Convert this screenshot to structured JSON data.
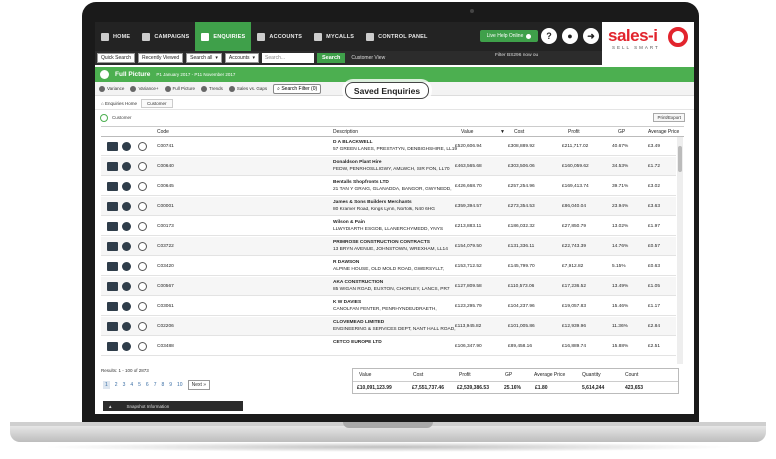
{
  "nav": {
    "items": [
      {
        "label": "HOME",
        "icon": "home-icon"
      },
      {
        "label": "CAMPAIGNS",
        "icon": "campaigns-icon"
      },
      {
        "label": "ENQUIRIES",
        "icon": "enquiries-icon"
      },
      {
        "label": "ACCOUNTS",
        "icon": "accounts-icon"
      },
      {
        "label": "MYCALLS",
        "icon": "calls-icon"
      },
      {
        "label": "CONTROL PANEL",
        "icon": "control-panel-icon"
      }
    ],
    "live_help": "Live Help Online",
    "logo": "sales-i",
    "logo_sub": "SELL SMART"
  },
  "search": {
    "quick_search": "Quick Search",
    "recently_viewed": "Recently Viewed",
    "scope1": "Search all",
    "scope2": "Accounts",
    "placeholder": "Search...",
    "go": "Search",
    "customer_view": "Customer View",
    "filter": "Filter BS296 now ou"
  },
  "green_bar": {
    "title": "Full Picture",
    "period": "P1 January 2017 - P11 November 2017"
  },
  "toolbar": {
    "items": [
      "Variance",
      "Variance+",
      "Full Picture",
      "Trends",
      "Sales vs. Gaps"
    ],
    "search_filter": "Search Filter (0)",
    "saved_enquiries": "Saved Enquiries"
  },
  "crumbs": {
    "home": "Enquiries Home",
    "tab": "Customer"
  },
  "customer_label": "Customer",
  "print_export": "Print/Export",
  "columns": {
    "code": "Code",
    "description": "Description",
    "value": "Value",
    "cost": "Cost",
    "profit": "Profit",
    "gp": "GP",
    "avg_price": "Average Price",
    "quantity": "Quantity",
    "count": "Count"
  },
  "rows": [
    {
      "code": "C00741",
      "name": "D A BLACKWELL",
      "addr": "57 GREEN LANES, PRESTATYN, DENBIGHSHIRE, LL19",
      "value": "£520,606.94",
      "cost": "£308,889.92",
      "profit": "£211,717.02",
      "gp": "40.67%",
      "avg": "£3.49",
      "qty": "149,369",
      "count": "47,690"
    },
    {
      "code": "C00640",
      "name": "Donaldson Plant Hire",
      "addr": "FEDW, PENRHOSLLIGWY, AMLWCH, SIR FON, LL70",
      "value": "£463,565.68",
      "cost": "£303,506.06",
      "profit": "£160,059.62",
      "gp": "34.53%",
      "avg": "£1.72",
      "qty": "269,653",
      "count": "16,774"
    },
    {
      "code": "C00645",
      "name": "Bentalls Shopfronts LTD",
      "addr": "21 TAN Y GRAIG, GLANADDA, BANGOR, GWYNEDD,",
      "value": "£426,668.70",
      "cost": "£257,254.96",
      "profit": "£169,413.74",
      "gp": "39.71%",
      "avg": "£3.02",
      "qty": "141,443",
      "count": "35,315"
    },
    {
      "code": "C00001",
      "name": "James & Sons Builders Merchants",
      "addr": "80 Kramer Road, Kings Lynn, Norfolk, N40 6HG",
      "value": "£359,394.57",
      "cost": "£273,354.53",
      "profit": "£86,040.04",
      "gp": "23.94%",
      "avg": "£3.63",
      "qty": "98,993",
      "count": "4,616"
    },
    {
      "code": "C00173",
      "name": "Wilson & Pain",
      "addr": "LLWYDIARTH ESGOB, LLANERCHYMEDD, YNYS",
      "value": "£213,883.11",
      "cost": "£186,032.32",
      "profit": "£27,850.79",
      "gp": "13.02%",
      "avg": "£1.97",
      "qty": "108,596",
      "count": "5,532"
    },
    {
      "code": "C03722",
      "name": "PRIMROSE CONSTRUCTION CONTRACTS",
      "addr": "13 BRYN AVENUE, JOHNSTOWN, WREXHAM, LL14",
      "value": "£154,079.50",
      "cost": "£131,336.11",
      "profit": "£22,743.39",
      "gp": "14.76%",
      "avg": "£0.57",
      "qty": "271,773",
      "count": "322"
    },
    {
      "code": "C03420",
      "name": "R DAWSON",
      "addr": "ALPINE HOUSE, OLD MOLD ROAD, GWERSYLLT,",
      "value": "£153,712.52",
      "cost": "£145,799.70",
      "profit": "£7,912.82",
      "gp": "5.15%",
      "avg": "£0.63",
      "qty": "242,695",
      "count": "1,282"
    },
    {
      "code": "C00567",
      "name": "AKA CONSTRUCTION",
      "addr": "85 WIGAN ROAD, EUXTON, CHORLEY, LANCS, PR7",
      "value": "£127,809.58",
      "cost": "£110,573.06",
      "profit": "£17,236.52",
      "gp": "13.49%",
      "avg": "£1.05",
      "qty": "121,455",
      "count": "422"
    },
    {
      "code": "C03061",
      "name": "K W DAVIES",
      "addr": "CANOLFAN FENTER, PENRHYNDEUDRAETH,",
      "value": "£123,295.79",
      "cost": "£104,237.96",
      "profit": "£19,057.83",
      "gp": "15.46%",
      "avg": "£1.17",
      "qty": "105,752",
      "count": "1,088"
    },
    {
      "code": "C02206",
      "name": "CLOVEMEAD LIMITED",
      "addr": "ENGINEERING & SERVICES DEPT, NANT HALL ROAD,",
      "value": "£113,945.82",
      "cost": "£101,005.86",
      "profit": "£12,939.96",
      "gp": "11.36%",
      "avg": "£2.84",
      "qty": "40,137",
      "count": "1,926"
    },
    {
      "code": "C03488",
      "name": "CETCO EUROPE LTD",
      "addr": "",
      "value": "£106,347.90",
      "cost": "£89,458.16",
      "profit": "£16,889.74",
      "gp": "15.88%",
      "avg": "£2.51",
      "qty": "42,385",
      "count": "1,496"
    }
  ],
  "footer": {
    "results": "Results: 1 - 100 of 2873",
    "pages": [
      "1",
      "2",
      "3",
      "4",
      "5",
      "6",
      "7",
      "8",
      "9",
      "10"
    ],
    "next": "Next »",
    "snapshot": "Snapshot Information"
  },
  "totals": {
    "value": "£10,091,123.99",
    "cost": "£7,551,737.46",
    "profit": "£2,539,386.53",
    "gp": "25.16%",
    "avg": "£1.80",
    "qty": "5,614,244",
    "count": "423,653"
  }
}
